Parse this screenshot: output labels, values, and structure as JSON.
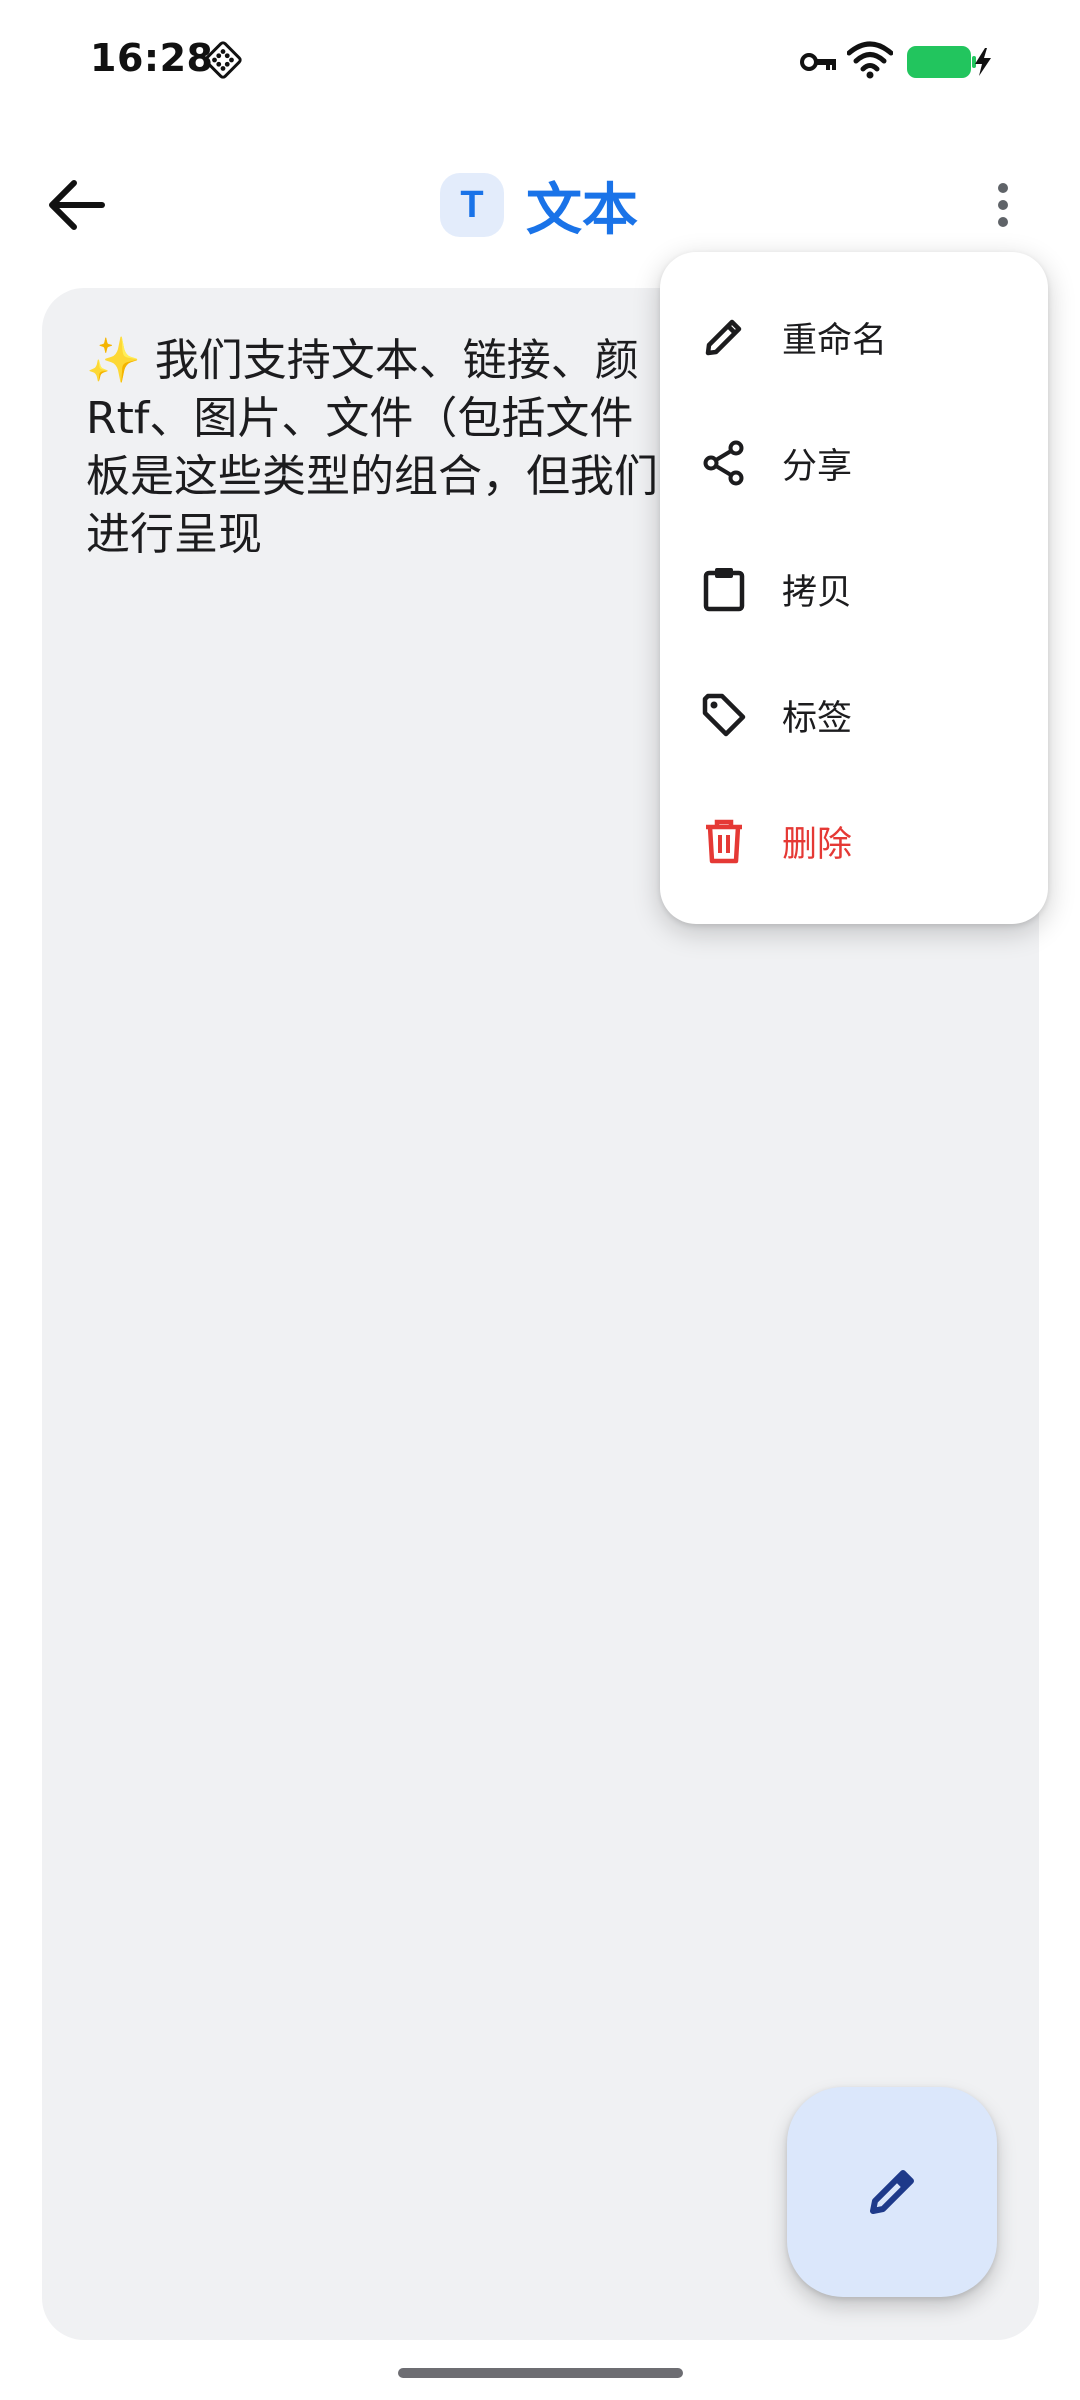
{
  "status_bar": {
    "time": "16:28",
    "icons": [
      "notification-icon",
      "vpn-key-icon",
      "wifi-icon",
      "battery-charging-icon"
    ],
    "battery_color": "#22c55e"
  },
  "app_bar": {
    "back_icon": "arrow-left-icon",
    "type_badge": "T",
    "title": "文本",
    "overflow_icon": "more-vertical-icon",
    "title_color": "#1a73e8"
  },
  "content": {
    "text": "✨ 我们支持文本、链接、颜\nRtf、图片、文件（包括文件\n板是这些类型的组合，但我们\n进行呈现"
  },
  "menu": {
    "items": [
      {
        "label": "重命名",
        "icon": "pencil-icon"
      },
      {
        "label": "分享",
        "icon": "share-icon"
      },
      {
        "label": "拷贝",
        "icon": "clipboard-icon"
      },
      {
        "label": "标签",
        "icon": "tag-icon"
      },
      {
        "label": "删除",
        "icon": "trash-icon",
        "color": "#e53935"
      }
    ]
  },
  "fab": {
    "icon": "edit-pencil-icon",
    "color": "#1e3a8a"
  }
}
